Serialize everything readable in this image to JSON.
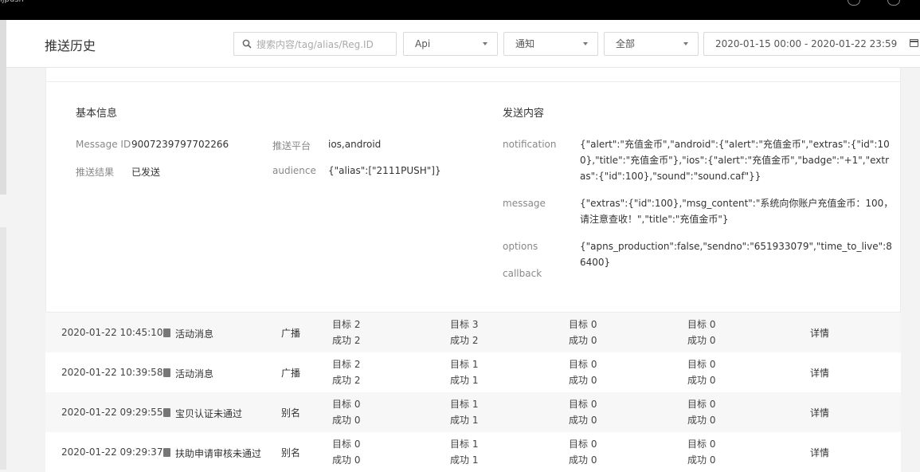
{
  "topbar": {
    "brand": "ijpush"
  },
  "header": {
    "title": "推送历史",
    "search_placeholder": "搜索内容/tag/alias/Reg.ID",
    "filters": {
      "platform": "Api",
      "type": "通知",
      "status": "全部"
    },
    "date_range": "2020-01-15 00:00 - 2020-01-22 23:59"
  },
  "detail": {
    "basic_title": "基本信息",
    "content_title": "发送内容",
    "message_id_label": "Message ID",
    "message_id": "9007239797702266",
    "platform_label": "推送平台",
    "platform": "ios,android",
    "result_label": "推送结果",
    "result": "已发送",
    "audience_label": "audience",
    "audience": "{\"alias\":[\"2111PUSH\"]}",
    "notification_label": "notification",
    "notification": "{\"alert\":\"充值金币\",\"android\":{\"alert\":\"充值金币\",\"extras\":{\"id\":100},\"title\":\"充值金币\"},\"ios\":{\"alert\":\"充值金币\",\"badge\":\"+1\",\"extras\":{\"id\":100},\"sound\":\"sound.caf\"}}",
    "message_label": "message",
    "message": "{\"extras\":{\"id\":100},\"msg_content\":\"系统向你账户充值金币：100，请注意查收！\",\"title\":\"充值金币\"}",
    "options_label": "options",
    "options": "{\"apns_production\":false,\"sendno\":\"651933079\",\"time_to_live\":86400}",
    "callback_label": "callback"
  },
  "rows": [
    {
      "time": "2020-01-22 10:45:10",
      "title": "活动消息",
      "type": "广播",
      "s1t": "目标 2",
      "s1s": "成功 2",
      "s2t": "目标 3",
      "s2s": "成功 2",
      "s3t": "目标 0",
      "s3s": "成功 0",
      "s4t": "目标 0",
      "s4s": "成功 0",
      "detail": "详情"
    },
    {
      "time": "2020-01-22 10:39:58",
      "title": "活动消息",
      "type": "广播",
      "s1t": "目标 2",
      "s1s": "成功 2",
      "s2t": "目标 1",
      "s2s": "成功 1",
      "s3t": "目标 0",
      "s3s": "成功 0",
      "s4t": "目标 0",
      "s4s": "成功 0",
      "detail": "详情"
    },
    {
      "time": "2020-01-22 09:29:55",
      "title": "宝贝认证未通过",
      "type": "别名",
      "s1t": "目标 0",
      "s1s": "成功 0",
      "s2t": "目标 1",
      "s2s": "成功 1",
      "s3t": "目标 0",
      "s3s": "成功 0",
      "s4t": "目标 0",
      "s4s": "成功 0",
      "detail": "详情"
    },
    {
      "time": "2020-01-22 09:29:37",
      "title": "扶助申请审核未通过",
      "type": "别名",
      "s1t": "目标 0",
      "s1s": "成功 0",
      "s2t": "目标 1",
      "s2s": "成功 1",
      "s3t": "目标 0",
      "s3s": "成功 0",
      "s4t": "目标 0",
      "s4s": "成功 0",
      "detail": "详情"
    }
  ]
}
